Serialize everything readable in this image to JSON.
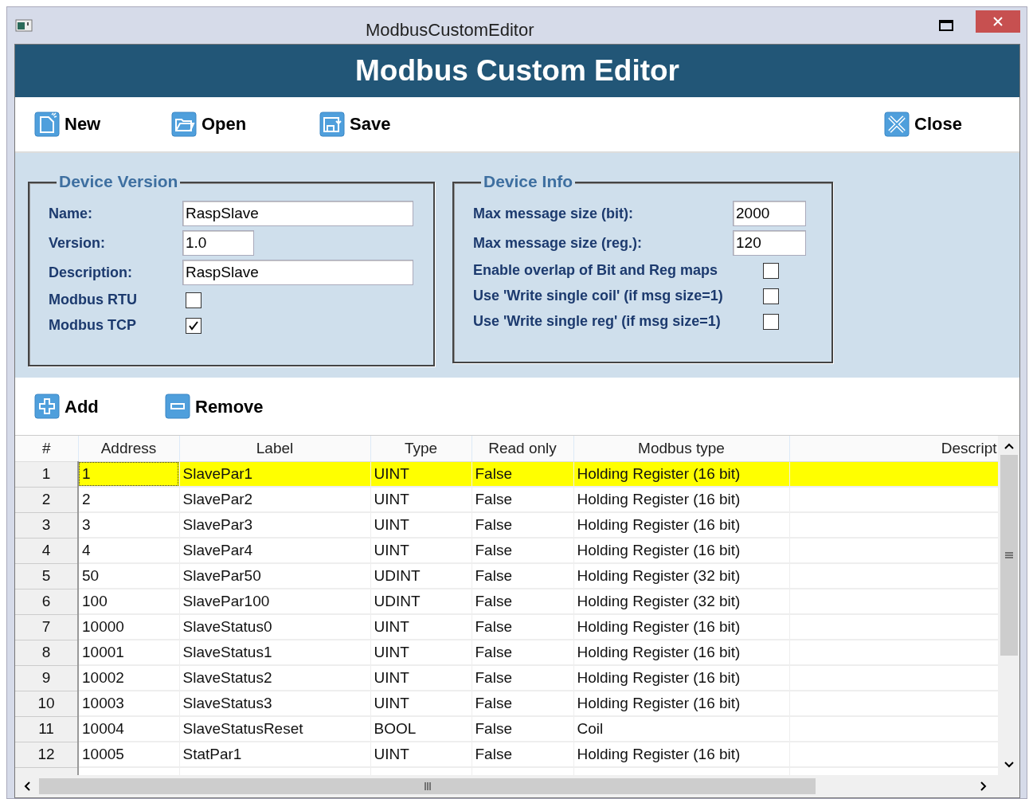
{
  "window": {
    "title": "ModbusCustomEditor"
  },
  "header": {
    "title": "Modbus Custom Editor"
  },
  "toolbar": [
    {
      "label": "New",
      "kind": "new"
    },
    {
      "label": "Open",
      "kind": "open"
    },
    {
      "label": "Save",
      "kind": "save"
    },
    {
      "label": "Close",
      "kind": "close"
    }
  ],
  "device_version": {
    "title": "Device Version",
    "fields": [
      {
        "label": "Name:",
        "kind": "text",
        "value": "RaspSlave"
      },
      {
        "label": "Version:",
        "kind": "short",
        "value": "1.0"
      },
      {
        "label": "Description:",
        "kind": "text",
        "value": "RaspSlave"
      },
      {
        "label": "Modbus RTU",
        "kind": "checkbox",
        "checked": false
      },
      {
        "label": "Modbus TCP",
        "kind": "checkbox",
        "checked": true
      }
    ]
  },
  "device_info": {
    "title": "Device Info",
    "fields": [
      {
        "label": "Max message size (bit):",
        "kind": "short",
        "value": "2000"
      },
      {
        "label": "Max message size (reg.):",
        "kind": "short",
        "value": "120"
      },
      {
        "label": "Enable overlap of Bit and Reg maps",
        "kind": "checkbox",
        "checked": false
      },
      {
        "label": "Use 'Write single coil' (if msg size=1)",
        "kind": "checkbox",
        "checked": false
      },
      {
        "label": "Use 'Write single reg' (if msg size=1)",
        "kind": "checkbox",
        "checked": false
      }
    ]
  },
  "table_actions": [
    {
      "label": "Add",
      "kind": "add"
    },
    {
      "label": "Remove",
      "kind": "remove"
    }
  ],
  "table": {
    "columns": [
      "#",
      "Address",
      "Label",
      "Type",
      "Read only",
      "Modbus type",
      "Descript"
    ],
    "rows": [
      {
        "cells": [
          "1",
          "1",
          "SlavePar1",
          "UINT",
          "False",
          "Holding Register (16 bit)"
        ],
        "selected": true
      },
      {
        "cells": [
          "2",
          "2",
          "SlavePar2",
          "UINT",
          "False",
          "Holding Register (16 bit)"
        ],
        "selected": false
      },
      {
        "cells": [
          "3",
          "3",
          "SlavePar3",
          "UINT",
          "False",
          "Holding Register (16 bit)"
        ],
        "selected": false
      },
      {
        "cells": [
          "4",
          "4",
          "SlavePar4",
          "UINT",
          "False",
          "Holding Register (16 bit)"
        ],
        "selected": false
      },
      {
        "cells": [
          "5",
          "50",
          "SlavePar50",
          "UDINT",
          "False",
          "Holding Register (32 bit)"
        ],
        "selected": false
      },
      {
        "cells": [
          "6",
          "100",
          "SlavePar100",
          "UDINT",
          "False",
          "Holding Register (32 bit)"
        ],
        "selected": false
      },
      {
        "cells": [
          "7",
          "10000",
          "SlaveStatus0",
          "UINT",
          "False",
          "Holding Register (16 bit)"
        ],
        "selected": false
      },
      {
        "cells": [
          "8",
          "10001",
          "SlaveStatus1",
          "UINT",
          "False",
          "Holding Register (16 bit)"
        ],
        "selected": false
      },
      {
        "cells": [
          "9",
          "10002",
          "SlaveStatus2",
          "UINT",
          "False",
          "Holding Register (16 bit)"
        ],
        "selected": false
      },
      {
        "cells": [
          "10",
          "10003",
          "SlaveStatus3",
          "UINT",
          "False",
          "Holding Register (16 bit)"
        ],
        "selected": false
      },
      {
        "cells": [
          "11",
          "10004",
          "SlaveStatusReset",
          "BOOL",
          "False",
          "Coil"
        ],
        "selected": false
      },
      {
        "cells": [
          "12",
          "10005",
          "StatPar1",
          "UINT",
          "False",
          "Holding Register (16 bit)"
        ],
        "selected": false
      }
    ]
  }
}
